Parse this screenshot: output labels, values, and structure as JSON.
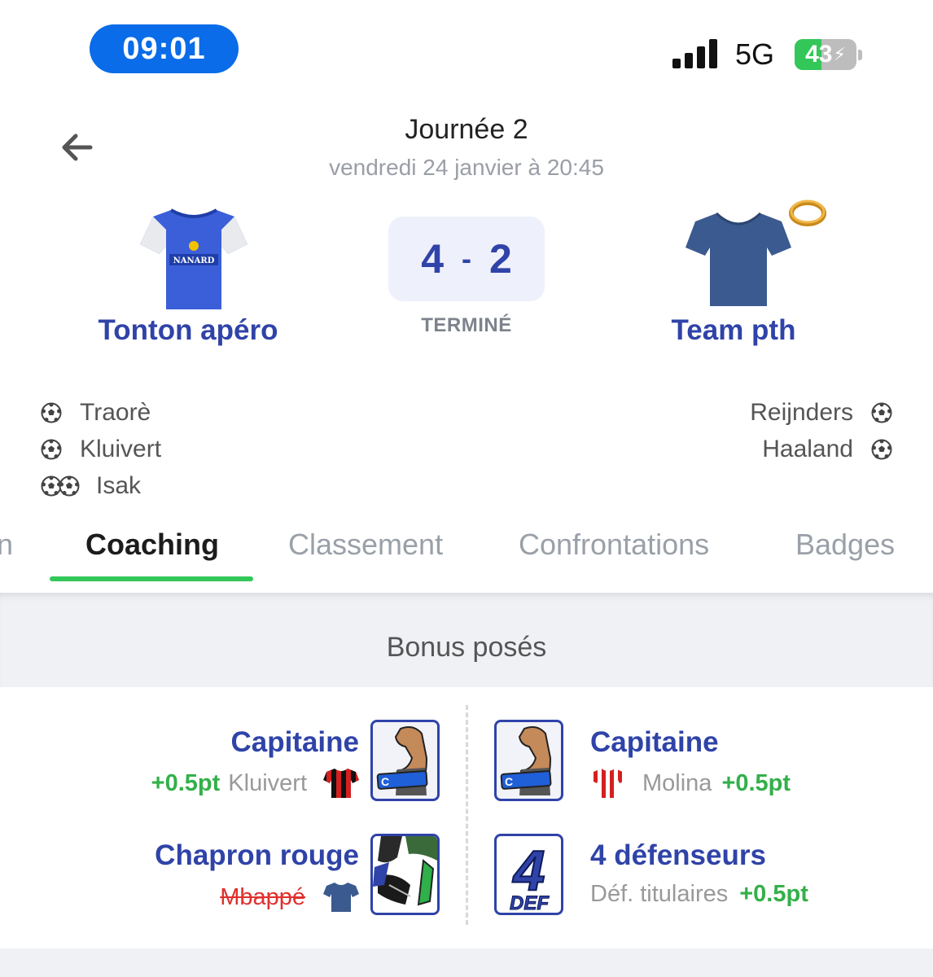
{
  "status_bar": {
    "time": "09:01",
    "network": "5G",
    "battery": "43",
    "battery_level": 0.43,
    "battery_color": "#33c759"
  },
  "header": {
    "back_icon": "arrow-left-icon",
    "title": "Journée 2",
    "subtitle": "vendredi 24 janvier à 20:45"
  },
  "match": {
    "home": {
      "name": "Tonton apéro",
      "jersey_text": "NANARD",
      "jersey_color": "#3a5fd8"
    },
    "away": {
      "name": "Team pth",
      "jersey_color": "#3b5a8f",
      "badge_icon": "ring-icon"
    },
    "score_home": "4",
    "score_separator": "-",
    "score_away": "2",
    "status": "TERMINÉ"
  },
  "scorers": {
    "home": [
      {
        "name": "Traorè",
        "goals": 1
      },
      {
        "name": "Kluivert",
        "goals": 1
      },
      {
        "name": "Isak",
        "goals": 2
      }
    ],
    "away": [
      {
        "name": "Reijnders",
        "goals": 1
      },
      {
        "name": "Haaland",
        "goals": 1
      }
    ]
  },
  "tabs": [
    {
      "label": "n",
      "active": false
    },
    {
      "label": "Coaching",
      "active": true
    },
    {
      "label": "Classement",
      "active": false
    },
    {
      "label": "Confrontations",
      "active": false
    },
    {
      "label": "Badges",
      "active": false
    }
  ],
  "bonus_section": {
    "title": "Bonus posés",
    "home": [
      {
        "title": "Capitaine",
        "points": "+0.5pt",
        "player": "Kluivert",
        "card_icon": "captain-armband-icon",
        "shirt_icon": "red-black-striped-shirt-icon"
      },
      {
        "title": "Chapron rouge",
        "player": "Mbappé",
        "player_struck": true,
        "card_icon": "red-card-tackle-icon",
        "shirt_icon": "navy-shirt-icon"
      }
    ],
    "away": [
      {
        "title": "Capitaine",
        "player": "Molina",
        "points": "+0.5pt",
        "card_icon": "captain-armband-icon",
        "shirt_icon": "red-white-striped-shirt-icon"
      },
      {
        "title": "4 défenseurs",
        "detail": "Déf. titulaires",
        "points": "+0.5pt",
        "card_icon": "four-def-icon",
        "card_number": "4",
        "card_text": "DEF"
      }
    ]
  },
  "colors": {
    "accent_blue": "#2f43a8",
    "positive_green": "#33b04a",
    "tab_active_underline": "#33c759",
    "struck_red": "#e0302e"
  }
}
